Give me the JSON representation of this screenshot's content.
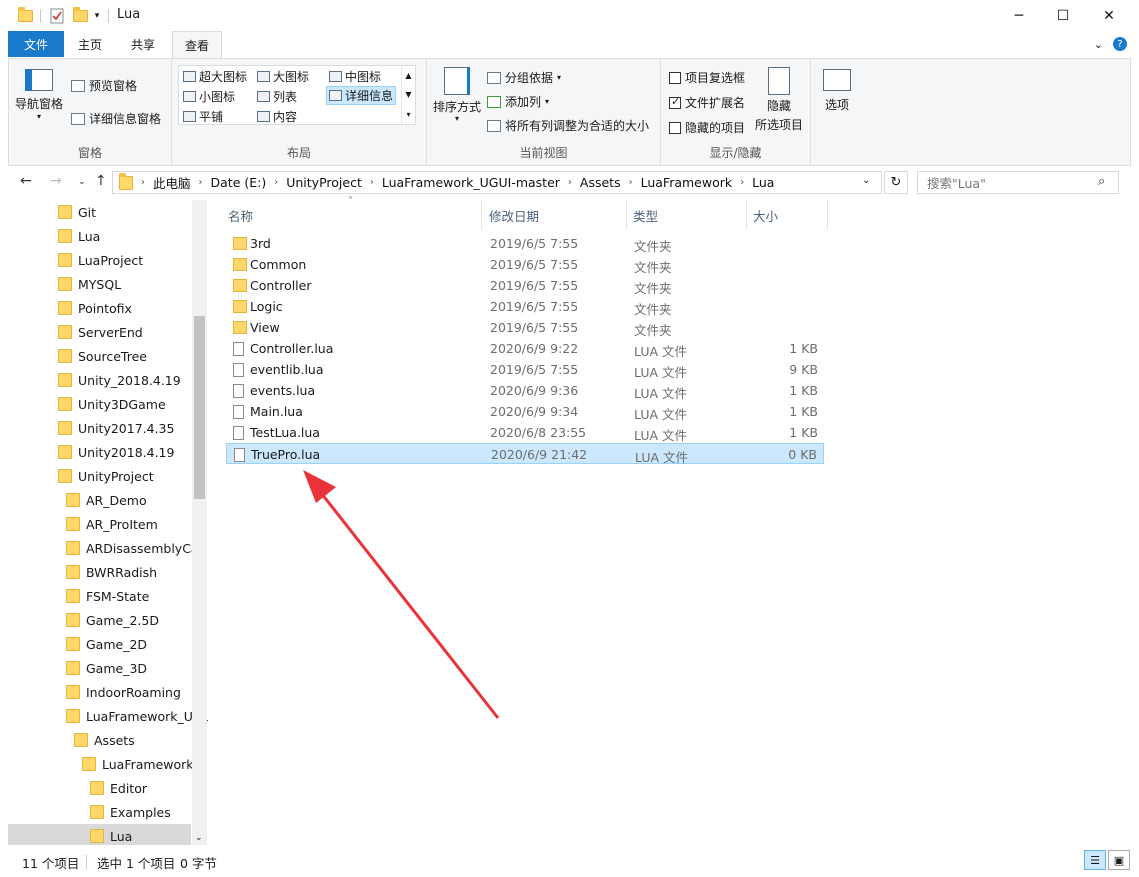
{
  "window": {
    "title": "Lua"
  },
  "tabs": {
    "file": "文件",
    "home": "主页",
    "share": "共享",
    "view": "查看"
  },
  "ribbon": {
    "panes": {
      "nav_pane": "导航窗格",
      "preview": "预览窗格",
      "details_pane": "详细信息窗格",
      "label": "窗格"
    },
    "layout": {
      "extra_large": "超大图标",
      "large": "大图标",
      "medium": "中图标",
      "small": "小图标",
      "list": "列表",
      "details": "详细信息",
      "tiles": "平铺",
      "content": "内容",
      "label": "布局"
    },
    "current_view": {
      "sort": "排序方式",
      "group": "分组依据",
      "add_col": "添加列",
      "fit_cols": "将所有列调整为合适的大小",
      "label": "当前视图"
    },
    "show_hide": {
      "item_checkbox": "项目复选框",
      "ext": "文件扩展名",
      "hidden": "隐藏的项目",
      "hide_sel": "隐藏",
      "hide_sel2": "所选项目",
      "label": "显示/隐藏"
    },
    "options": "选项"
  },
  "breadcrumb": [
    "此电脑",
    "Date (E:)",
    "UnityProject",
    "LuaFramework_UGUI-master",
    "Assets",
    "LuaFramework",
    "Lua"
  ],
  "search": {
    "placeholder": "搜索\"Lua\""
  },
  "nav_items": [
    {
      "label": "Git"
    },
    {
      "label": "Lua"
    },
    {
      "label": "LuaProject"
    },
    {
      "label": "MYSQL"
    },
    {
      "label": "Pointofix"
    },
    {
      "label": "ServerEnd"
    },
    {
      "label": "SourceTree"
    },
    {
      "label": "Unity_2018.4.19"
    },
    {
      "label": "Unity3DGame"
    },
    {
      "label": "Unity2017.4.35"
    },
    {
      "label": "Unity2018.4.19"
    },
    {
      "label": "UnityProject"
    },
    {
      "label": "AR_Demo"
    },
    {
      "label": "AR_ProItem"
    },
    {
      "label": "ARDisassemblyCar"
    },
    {
      "label": "BWRRadish"
    },
    {
      "label": "FSM-State"
    },
    {
      "label": "Game_2.5D"
    },
    {
      "label": "Game_2D"
    },
    {
      "label": "Game_3D"
    },
    {
      "label": "IndoorRoaming"
    },
    {
      "label": "LuaFramework_UGUI"
    },
    {
      "label": "Assets"
    },
    {
      "label": "LuaFramework"
    },
    {
      "label": "Editor"
    },
    {
      "label": "Examples"
    },
    {
      "label": "Lua"
    }
  ],
  "columns": {
    "name": "名称",
    "date": "修改日期",
    "type": "类型",
    "size": "大小"
  },
  "files": [
    {
      "name": "3rd",
      "date": "2019/6/5 7:55",
      "type": "文件夹",
      "size": ""
    },
    {
      "name": "Common",
      "date": "2019/6/5 7:55",
      "type": "文件夹",
      "size": ""
    },
    {
      "name": "Controller",
      "date": "2019/6/5 7:55",
      "type": "文件夹",
      "size": ""
    },
    {
      "name": "Logic",
      "date": "2019/6/5 7:55",
      "type": "文件夹",
      "size": ""
    },
    {
      "name": "View",
      "date": "2019/6/5 7:55",
      "type": "文件夹",
      "size": ""
    },
    {
      "name": "Controller.lua",
      "date": "2020/6/9 9:22",
      "type": "LUA 文件",
      "size": "1 KB"
    },
    {
      "name": "eventlib.lua",
      "date": "2019/6/5 7:55",
      "type": "LUA 文件",
      "size": "9 KB"
    },
    {
      "name": "events.lua",
      "date": "2020/6/9 9:36",
      "type": "LUA 文件",
      "size": "1 KB"
    },
    {
      "name": "Main.lua",
      "date": "2020/6/9 9:34",
      "type": "LUA 文件",
      "size": "1 KB"
    },
    {
      "name": "TestLua.lua",
      "date": "2020/6/8 23:55",
      "type": "LUA 文件",
      "size": "1 KB"
    },
    {
      "name": "TruePro.lua",
      "date": "2020/6/9 21:42",
      "type": "LUA 文件",
      "size": "0 KB"
    }
  ],
  "status": {
    "count": "11 个项目",
    "selected": "选中 1 个项目",
    "bytes": "0 字节"
  },
  "colors": {
    "accent": "#1979ca",
    "selection": "#cce8ff",
    "arrow": "#e8333a"
  }
}
